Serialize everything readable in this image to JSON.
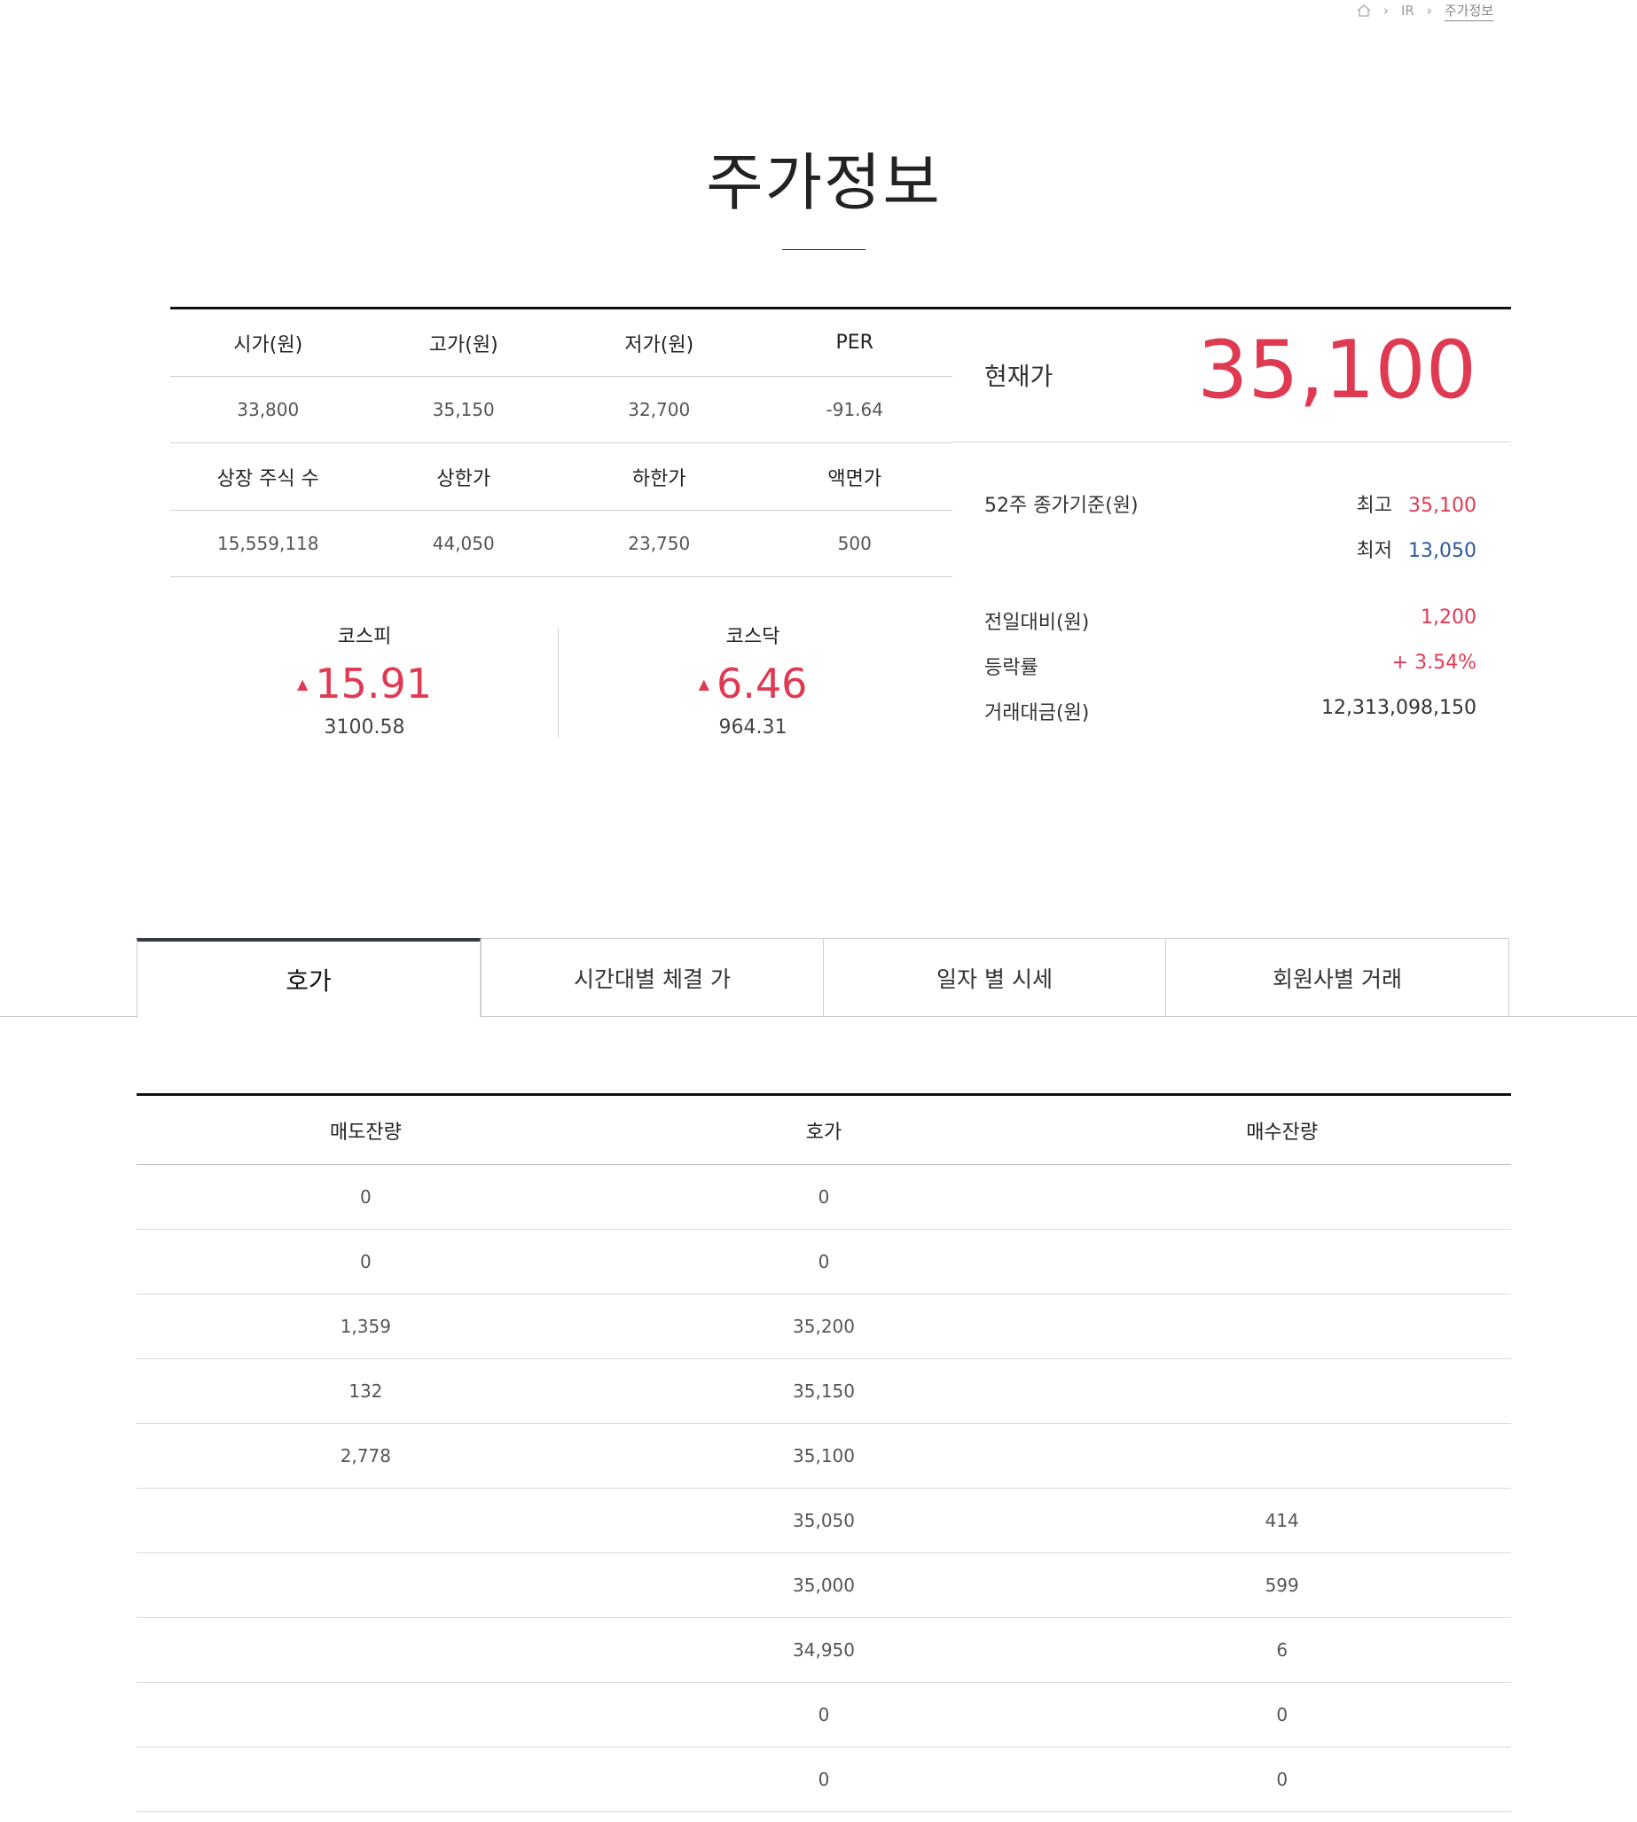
{
  "breadcrumb": {
    "home_icon": "home-icon",
    "sep": "›",
    "level1": "IR",
    "current": "주가정보"
  },
  "page_title": "주가정보",
  "info_grid": {
    "row1_headers": [
      "시가(원)",
      "고가(원)",
      "저가(원)",
      "PER"
    ],
    "row1_values": [
      "33,800",
      "35,150",
      "32,700",
      "-91.64"
    ],
    "row2_headers": [
      "상장 주식 수",
      "상한가",
      "하한가",
      "액면가"
    ],
    "row2_values": [
      "15,559,118",
      "44,050",
      "23,750",
      "500"
    ]
  },
  "indices": [
    {
      "name": "코스피",
      "arrow": "▲",
      "change": "15.91",
      "level": "3100.58"
    },
    {
      "name": "코스닥",
      "arrow": "▲",
      "change": "6.46",
      "level": "964.31"
    }
  ],
  "current": {
    "label": "현재가",
    "price": "35,100"
  },
  "week52": {
    "label": "52주 종가기준(원)",
    "high_label": "최고",
    "high_value": "35,100",
    "low_label": "최저",
    "low_value": "13,050"
  },
  "stats": {
    "change_label": "전일대비(원)",
    "change_value": "1,200",
    "rate_label": "등락률",
    "rate_value": "+ 3.54%",
    "amount_label": "거래대금(원)",
    "amount_value": "12,313,098,150"
  },
  "tabs": [
    "호가",
    "시간대별 체결 가",
    "일자 별 시세",
    "회원사별 거래"
  ],
  "order_table": {
    "headers": [
      "매도잔량",
      "호가",
      "매수잔량"
    ],
    "rows": [
      [
        "0",
        "0",
        ""
      ],
      [
        "0",
        "0",
        ""
      ],
      [
        "1,359",
        "35,200",
        ""
      ],
      [
        "132",
        "35,150",
        ""
      ],
      [
        "2,778",
        "35,100",
        ""
      ],
      [
        "",
        "35,050",
        "414"
      ],
      [
        "",
        "35,000",
        "599"
      ],
      [
        "",
        "34,950",
        "6"
      ],
      [
        "",
        "0",
        "0"
      ],
      [
        "",
        "0",
        "0"
      ]
    ]
  },
  "colors": {
    "up": "#e03a53",
    "down": "#2e5a9e"
  }
}
